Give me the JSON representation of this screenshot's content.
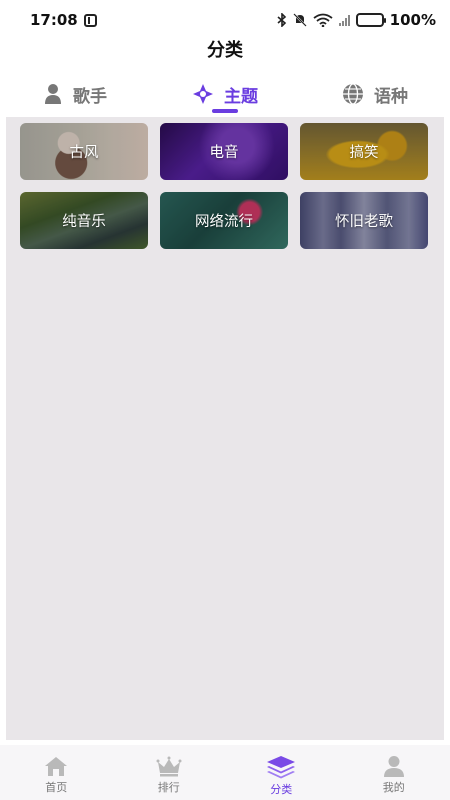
{
  "status_bar": {
    "time": "17:08",
    "battery": "100%"
  },
  "header": {
    "title": "分类"
  },
  "tabs": [
    {
      "label": "歌手",
      "icon": "person-icon",
      "active": false
    },
    {
      "label": "主题",
      "icon": "compass-icon",
      "active": true
    },
    {
      "label": "语种",
      "icon": "globe-icon",
      "active": false
    }
  ],
  "categories": [
    {
      "label": "古风"
    },
    {
      "label": "电音"
    },
    {
      "label": "搞笑"
    },
    {
      "label": "纯音乐"
    },
    {
      "label": "网络流行"
    },
    {
      "label": "怀旧老歌"
    }
  ],
  "bottom_nav": [
    {
      "label": "首页",
      "icon": "home-icon",
      "active": false
    },
    {
      "label": "排行",
      "icon": "crown-icon",
      "active": false
    },
    {
      "label": "分类",
      "icon": "layers-icon",
      "active": true
    },
    {
      "label": "我的",
      "icon": "user-icon",
      "active": false
    }
  ],
  "colors": {
    "accent": "#6a3de0",
    "inactive": "#777777",
    "panel_bg": "#e9e6e9"
  }
}
